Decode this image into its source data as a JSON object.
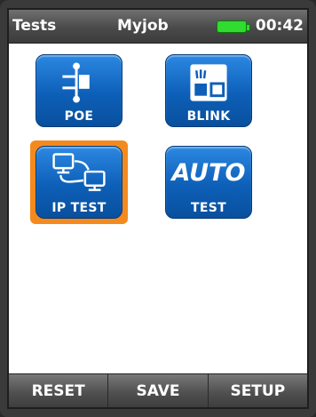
{
  "status": {
    "title": "Tests",
    "job": "Myjob",
    "time": "00:42",
    "battery_icon": "battery-full-icon",
    "battery_color": "#2fdc2f"
  },
  "tiles": [
    {
      "label": "POE",
      "icon": "poe-icon",
      "selected": false
    },
    {
      "label": "BLINK",
      "icon": "blink-icon",
      "selected": false
    },
    {
      "label": "IP TEST",
      "icon": "network-computers-icon",
      "selected": true
    },
    {
      "label": "TEST",
      "icon_text": "AUTO",
      "selected": false
    }
  ],
  "softkeys": [
    "RESET",
    "SAVE",
    "SETUP"
  ],
  "colors": {
    "tile_blue": "#0d5fb8",
    "selection_orange": "#f48a1e",
    "bar_gray": "#4a4a4a"
  }
}
